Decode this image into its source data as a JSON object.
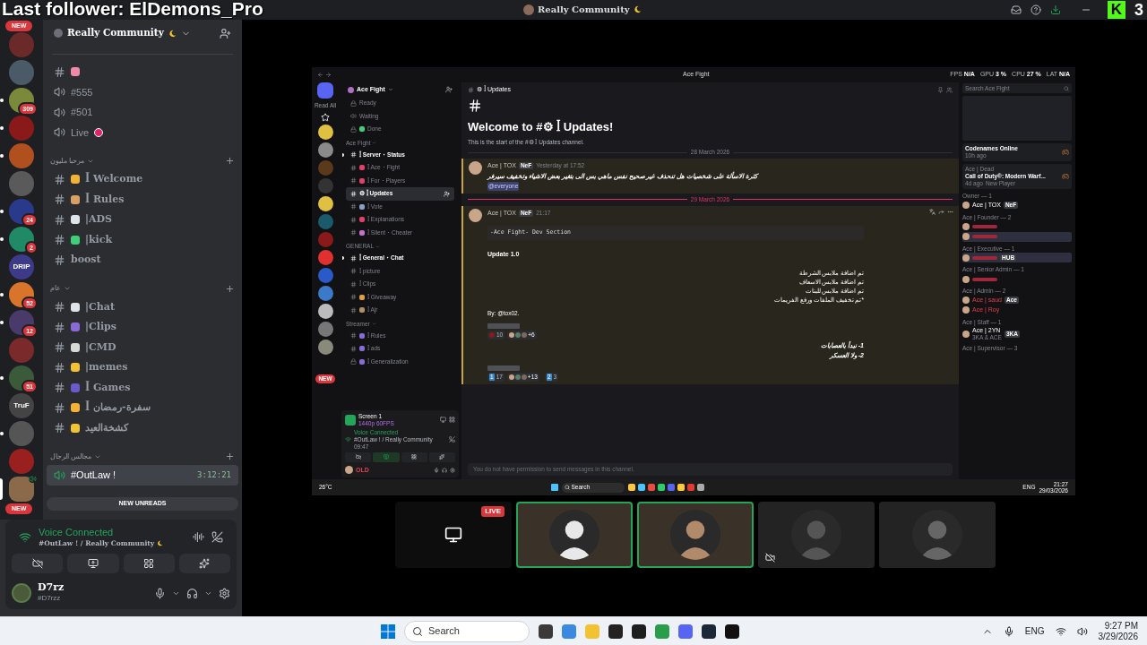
{
  "overlay": {
    "follower_text": "Last follower: ElDemons_Pro"
  },
  "title_bar": {
    "title": "Really Community",
    "logo_letter": "K",
    "logo_count": "3"
  },
  "server_rail": {
    "new_top": "NEW",
    "new_bottom": "NEW",
    "servers": [
      {
        "color": "#6a2a2a",
        "unread": false,
        "selected": false
      },
      {
        "color": "#4a5a66",
        "unread": false,
        "selected": false
      },
      {
        "color": "#7a8a3a",
        "unread": true,
        "badge": "309",
        "selected": false
      },
      {
        "color": "#8a1a1a",
        "unread": true,
        "selected": false
      },
      {
        "color": "#b0501e",
        "unread": true,
        "selected": false
      },
      {
        "color": "#5a5a5a",
        "unread": false,
        "selected": false
      },
      {
        "color": "#2a3a8a",
        "unread": true,
        "badge": "24",
        "selected": false
      },
      {
        "color": "#1f8a65",
        "unread": true,
        "badge": "2",
        "selected": false
      },
      {
        "color": "#3e3a8a",
        "unread": false,
        "label": "DRIP",
        "selected": false
      },
      {
        "color": "#d8752a",
        "unread": true,
        "badge": "52",
        "selected": false
      },
      {
        "color": "#4a3a6a",
        "unread": true,
        "badge": "12",
        "selected": false
      },
      {
        "color": "#7a2a2a",
        "unread": false,
        "selected": false
      },
      {
        "color": "#3a5a3a",
        "unread": true,
        "badge": "51",
        "selected": false
      },
      {
        "color": "#444444",
        "unread": false,
        "label": "TruF",
        "selected": false
      },
      {
        "color": "#555555",
        "unread": true,
        "selected": false
      },
      {
        "color": "#9a2020",
        "unread": false,
        "selected": false
      },
      {
        "color": "#8a6a4a",
        "unread": false,
        "selected": true
      }
    ]
  },
  "server": {
    "name": "Really Community",
    "sections": [
      {
        "channels": [
          {
            "kind": "text",
            "color": "#f08aa8",
            "selected": false
          },
          {
            "kind": "voice",
            "name": "#555",
            "selected": false
          },
          {
            "kind": "voice",
            "name": "#501",
            "selected": false
          },
          {
            "kind": "voice",
            "name": "Live",
            "live": true,
            "selected": false
          }
        ]
      },
      {
        "category": "مرحبا مليون",
        "channels": [
          {
            "kind": "text",
            "color": "#f2b233",
            "name": "ꟾ Welcome",
            "selected": false
          },
          {
            "kind": "text",
            "color": "#d9a066",
            "name": "ꟾ Rules",
            "selected": false
          },
          {
            "kind": "text",
            "color": "#dfe3ea",
            "name": "|ADS",
            "selected": false
          },
          {
            "kind": "text",
            "color": "#3fcf7a",
            "name": "|kick",
            "selected": false
          },
          {
            "kind": "text",
            "name": "boost",
            "selected": false
          }
        ]
      },
      {
        "category": "عام",
        "channels": [
          {
            "kind": "text",
            "color": "#dfe3ea",
            "name": "|Chat",
            "selected": false
          },
          {
            "kind": "text",
            "color": "#8a6ad6",
            "name": "|Clips",
            "selected": false
          },
          {
            "kind": "text",
            "color": "#d8d8d8",
            "name": "|CMD",
            "selected": false
          },
          {
            "kind": "text",
            "color": "#f2c233",
            "name": "|memes",
            "selected": false
          },
          {
            "kind": "text",
            "color": "#6a5acd",
            "name": "ꟾ Games",
            "selected": false
          },
          {
            "kind": "text",
            "color": "#f2b233",
            "name": "ꟾ سفرة-رمضان",
            "selected": false
          },
          {
            "kind": "text",
            "color": "#f2c233",
            "name": "كشخةالعيد",
            "selected": false
          }
        ]
      },
      {
        "category": "مجالس الرجال",
        "channels": [
          {
            "kind": "voice",
            "name": "#OutLaw !",
            "timer": "3:12:21",
            "selected": true
          }
        ]
      }
    ]
  },
  "new_unreads": "NEW UNREADS",
  "voice_panel": {
    "status": "Voice Connected",
    "location": "#OutLaw ! / Really Community"
  },
  "user_panel": {
    "name": "D7rz",
    "tag": "#D7rzz"
  },
  "stream": {
    "window_title": "Ace Fight",
    "perf": [
      {
        "label": "FPS",
        "value": "N/A"
      },
      {
        "label": "GPU",
        "value": "3 %"
      },
      {
        "label": "CPU",
        "value": "27 %"
      },
      {
        "label": "LAT",
        "value": "N/A"
      }
    ],
    "rail": {
      "read_all": "Read All",
      "new": "NEW",
      "servers": [
        {
          "color": "#e0c040"
        },
        {
          "color": "#8a8a8a"
        },
        {
          "color": "#5a3a1a"
        },
        {
          "color": "#333333"
        },
        {
          "color": "#e0c040"
        },
        {
          "color": "#1a5a6a"
        },
        {
          "color": "#8a1a1a"
        },
        {
          "color": "#e03030"
        },
        {
          "color": "#2a5ac8"
        },
        {
          "color": "#3a7ac8"
        },
        {
          "color": "#bbbbbb"
        },
        {
          "color": "#777777"
        },
        {
          "color": "#8a8a7a"
        }
      ]
    },
    "server_name": "Ace Fight",
    "sections": [
      {
        "channels": [
          {
            "kind": "locked",
            "name": "Ready",
            "unread": false,
            "selected": false
          },
          {
            "kind": "voice",
            "name": "Waiting",
            "unread": false,
            "selected": false
          },
          {
            "kind": "locked",
            "name": "Done",
            "color": "#3fcf7a",
            "unread": false,
            "selected": false
          }
        ]
      },
      {
        "category": "Ace Fight",
        "channels": [
          {
            "kind": "text",
            "name": "ꟾ Server・Status",
            "unread": true,
            "selected": false
          },
          {
            "kind": "text",
            "name": "ꟾ Ace・Fight",
            "color": "#e0406a",
            "unread": false,
            "selected": false
          },
          {
            "kind": "text",
            "name": "ꟾ For・Players",
            "color": "#e0406a",
            "unread": false,
            "selected": false
          },
          {
            "kind": "text",
            "name": "⚙ ꟾ Updates",
            "unread": false,
            "selected": true
          },
          {
            "kind": "text",
            "name": "ꟾ Vote",
            "color": "#8aa0c8",
            "unread": false,
            "selected": false
          },
          {
            "kind": "text",
            "name": "ꟾ Explanations",
            "color": "#e0406a",
            "unread": false,
            "selected": false
          },
          {
            "kind": "text",
            "name": "ꟾ Silent・Cheater",
            "color": "#c870c8",
            "unread": false,
            "selected": false
          }
        ]
      },
      {
        "category": "GENERAL",
        "channels": [
          {
            "kind": "text",
            "name": "ꟾ General・Chat",
            "unread": true,
            "selected": false
          },
          {
            "kind": "text",
            "name": "ꟾ picture",
            "unread": false,
            "selected": false
          },
          {
            "kind": "text",
            "name": "ꟾ Clips",
            "unread": false,
            "selected": false
          },
          {
            "kind": "text",
            "name": "ꟾ Giveaway",
            "color": "#e0a040",
            "unread": false,
            "selected": false
          },
          {
            "kind": "text",
            "name": "ꟾ Ajr",
            "color": "#b09060",
            "unread": false,
            "selected": false
          }
        ]
      },
      {
        "category": "Streamer",
        "channels": [
          {
            "kind": "text",
            "name": "ꟾ Rules",
            "color": "#8a6ad6",
            "unread": false,
            "selected": false
          },
          {
            "kind": "text",
            "name": "ꟾ ads",
            "color": "#8a6ad6",
            "unread": false,
            "selected": false
          },
          {
            "kind": "locked",
            "name": "ꟾ Generalization",
            "color": "#8a6ad6",
            "unread": false,
            "selected": false
          }
        ]
      }
    ],
    "screen_panel": {
      "title": "Screen 1",
      "quality": "1440p 60FPS",
      "status": "Voice Connected",
      "location": "#OutLaw ! / Really Community",
      "elapsed": "09:47",
      "user": "OLD"
    },
    "chat": {
      "channel": "⚙ ꟾ Updates",
      "welcome": "Welcome to #⚙ ꟾ Updates!",
      "intro": "This is the start of the #⚙ ꟾ Updates channel.",
      "messages": [
        {
          "date": "28 March 2026",
          "new_divider": false,
          "author": "Ace | TOX",
          "tag": "NeF",
          "time": "Yesterday at 17:52",
          "lines": [
            "كثرة الاسألة على شخصيات هل تنحذف غير صحيح نفس ماهي بس الى بتغير بعض الاشياء وتخفيف سيرفر"
          ],
          "mention": "@everyone"
        },
        {
          "date": "29 March 2026",
          "new_divider": true,
          "author": "Ace | TOX",
          "tag": "NeF",
          "time": "21:17",
          "code": "-Ace Fight- Dev Section",
          "heading": "Update 1.0",
          "lines": [
            "تم اضافة ملابس الشرطة",
            "تم اضافة ملابس الاسعاف",
            "تم اضافة ملابس للبنات",
            "*تم تخفيف الملفات ورفع الفريمات"
          ],
          "signature": "By: @tox02.",
          "poll_groups": [
            {
              "reactions": [
                {
                  "count": "10",
                  "more": "+6"
                }
              ],
              "lines": [
                "1- نبدأ بالعصابات",
                "2- ولا العسكر"
              ]
            },
            {
              "reactions": [
                {
                  "emoji": "1",
                  "count": "17",
                  "more": "+13"
                },
                {
                  "emoji": "2",
                  "count": "3"
                }
              ]
            }
          ]
        }
      ],
      "placeholder": "You do not have permission to send messages in this channel."
    },
    "members": {
      "search_placeholder": "Search Ace Fight",
      "activities": [
        {
          "title": "Codenames Online",
          "time": "10h ago"
        },
        {
          "user": "Ace | Dead",
          "title": "Call of Duty®: Modern Warf...",
          "time": "4d ago",
          "extra": "New Player"
        }
      ],
      "groups": [
        {
          "title": "Owner — 1",
          "members": [
            {
              "kind": "named",
              "name": "Ace | TOX",
              "tag": "NeF",
              "red": false,
              "highlighted": false
            }
          ]
        },
        {
          "title": "Ace | Founder — 2",
          "members": [
            {
              "kind": "blurred",
              "highlighted": false
            },
            {
              "kind": "blurred",
              "highlighted": true
            }
          ]
        },
        {
          "title": "Ace | Executive — 1",
          "members": [
            {
              "kind": "blurred",
              "tag": "HUB",
              "highlighted": true
            }
          ]
        },
        {
          "title": "Ace | Senior Admin — 1",
          "members": [
            {
              "kind": "blurred",
              "highlighted": false
            }
          ]
        },
        {
          "title": "Ace | Admin — 2",
          "members": [
            {
              "kind": "named",
              "name": "Ace | saud",
              "tag": "Ace",
              "red": true,
              "highlighted": false
            },
            {
              "kind": "named",
              "name": "Ace | Roy",
              "red": true,
              "highlighted": false
            }
          ]
        },
        {
          "title": "Ace | Staff — 1",
          "members": [
            {
              "kind": "named",
              "name": "Ace | 2YN",
              "tag": "3KA",
              "status": "3KA & ACE",
              "red": false,
              "highlighted": false
            }
          ]
        },
        {
          "title": "Ace | Supervisor — 3"
        }
      ]
    },
    "taskbar": {
      "weather": "26°C",
      "search": "Search",
      "lang": "ENG",
      "time": "21:27",
      "date": "29/03/2026"
    }
  },
  "participants": [
    {
      "kind": "stream",
      "badge": "LIVE",
      "speaking": false
    },
    {
      "kind": "user",
      "speaking": true,
      "color": "#e8e8e8"
    },
    {
      "kind": "user",
      "speaking": true,
      "color": "#b08a6a"
    },
    {
      "kind": "user",
      "speaking": false,
      "muted_video": true,
      "color": "#555555"
    },
    {
      "kind": "user",
      "speaking": false,
      "color": "#666666"
    }
  ],
  "taskbar": {
    "search": "Search",
    "lang": "ENG",
    "time": "9:27 PM",
    "date": "3/29/2026"
  }
}
